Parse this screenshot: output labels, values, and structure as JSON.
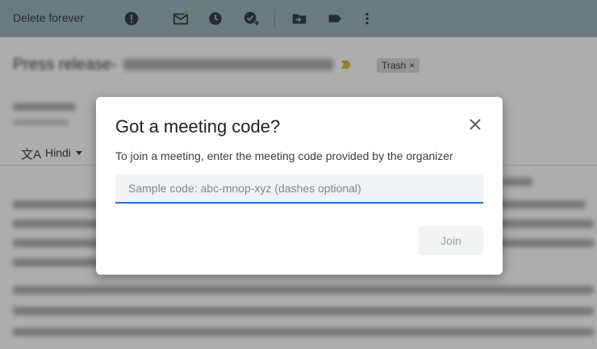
{
  "toolbar": {
    "delete_forever_label": "Delete forever",
    "icons": [
      "report-spam-icon",
      "mark-unread-icon",
      "snooze-icon",
      "add-to-tasks-icon",
      "move-to-icon",
      "label-icon",
      "more-vert-icon"
    ]
  },
  "email": {
    "subject_visible_prefix": "Press release-",
    "trash_chip_label": "Trash",
    "trash_chip_close": "×",
    "translate_language": "Hindi",
    "translate_icon_glyph": "文A"
  },
  "dialog": {
    "title": "Got a meeting code?",
    "close_glyph": "×",
    "description": "To join a meeting, enter the meeting code provided by the organizer",
    "input_placeholder": "Sample code: abc-mnop-xyz (dashes optional)",
    "input_value": "",
    "join_label": "Join",
    "accent_color": "#1a73e8"
  }
}
